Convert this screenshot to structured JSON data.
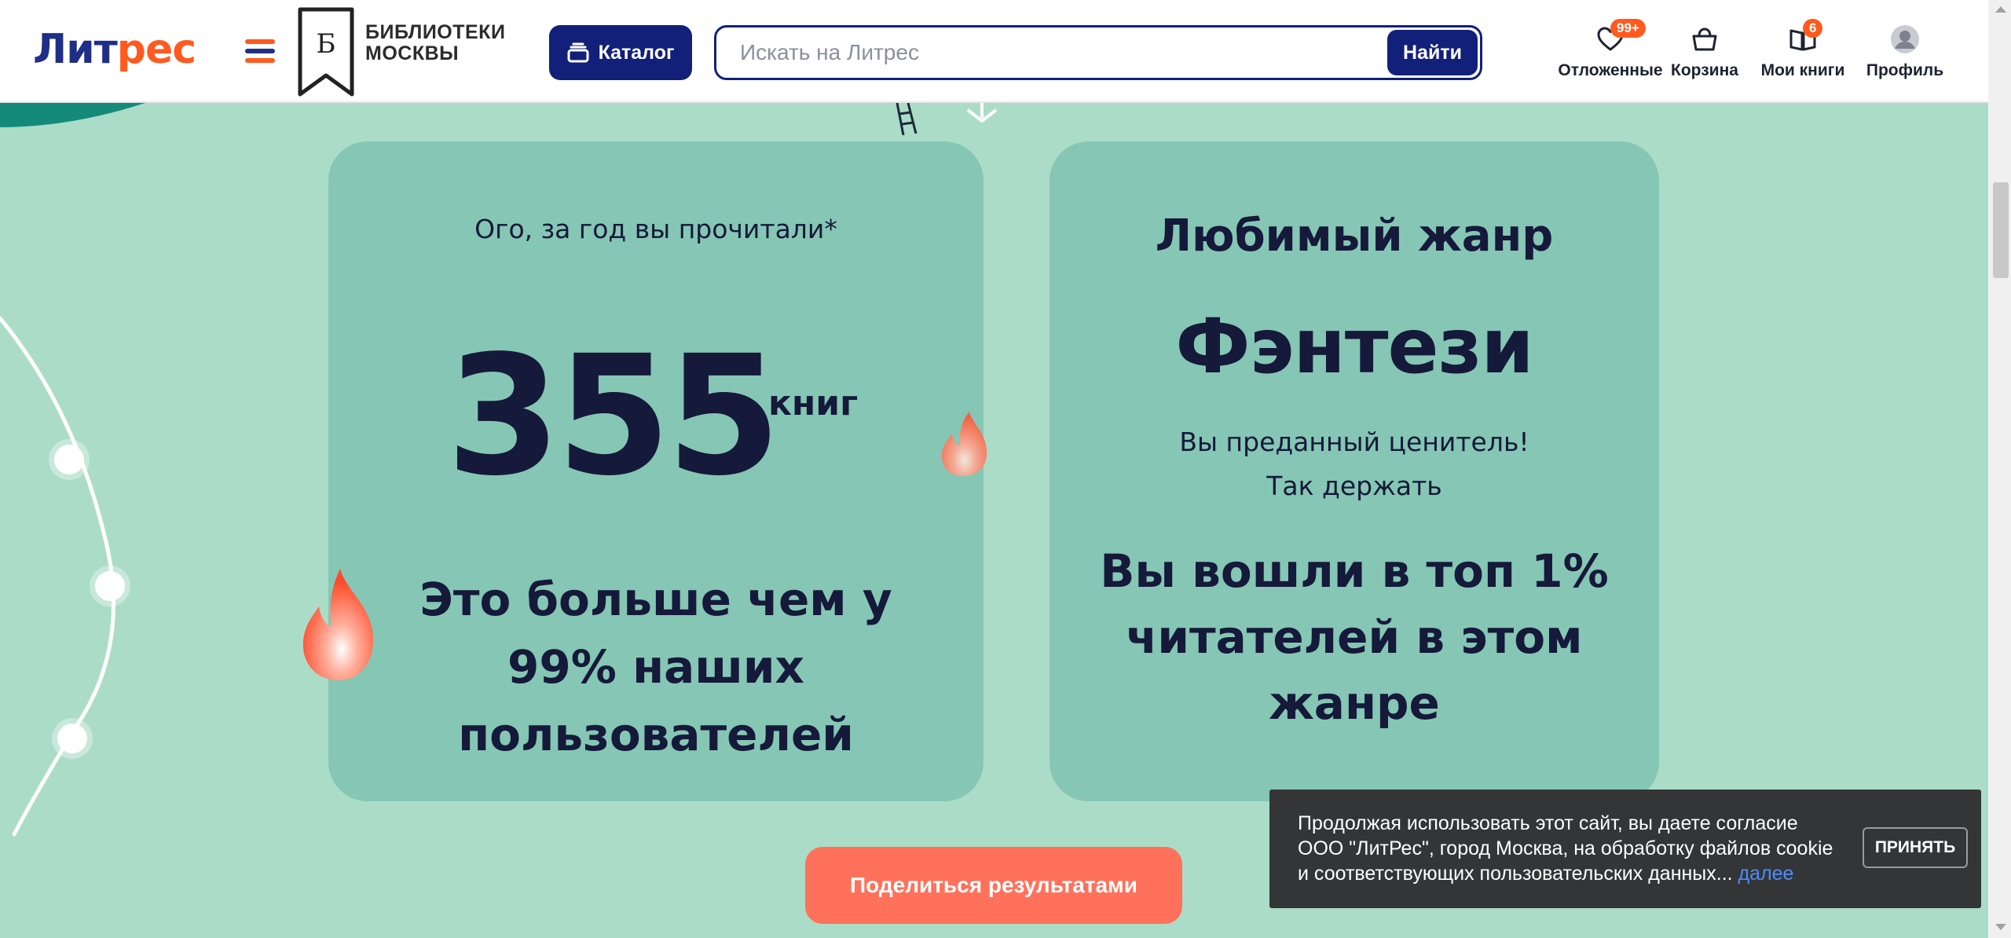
{
  "header": {
    "logo_part1": "Лит",
    "logo_part2": "рес",
    "library_flag_letter": "Б",
    "library_line1": "БИБЛИОТЕКИ",
    "library_line2": "МОСКВЫ",
    "catalog_label": "Каталог",
    "search_placeholder": "Искать на Литрес",
    "search_button": "Найти",
    "nav": [
      {
        "label": "Отложенные",
        "icon": "heart-icon",
        "badge": "99+"
      },
      {
        "label": "Корзина",
        "icon": "basket-icon",
        "badge": ""
      },
      {
        "label": "Мои книги",
        "icon": "book-icon",
        "badge": "6"
      },
      {
        "label": "Профиль",
        "icon": "profile-icon",
        "badge": ""
      }
    ]
  },
  "stats_card": {
    "label": "Ого, за год вы прочитали*",
    "count": "355",
    "unit": "книг",
    "comparison": "Это больше чем у 99% наших пользователей"
  },
  "genre_card": {
    "label": "Любимый жанр",
    "genre": "Фэнтези",
    "praise_line1": "Вы преданный ценитель!",
    "praise_line2": "Так держать",
    "rank": "Вы вошли в топ 1% читателей в этом жанре"
  },
  "share_button": "Поделиться результатами",
  "cookie": {
    "text": "Продолжая использовать этот сайт, вы даете согласие ООО \"ЛитРес\", город Москва, на обработку файлов cookie и соответствующих пользовательских данных...",
    "link": "далее",
    "accept": "ПРИНЯТЬ"
  },
  "colors": {
    "brand_blue": "#12207a",
    "brand_orange": "#ff5a1f",
    "page_background": "#abdcc8",
    "card_background": "#86c6b4",
    "share_button": "#ff715b",
    "cookie_background": "#333537"
  }
}
